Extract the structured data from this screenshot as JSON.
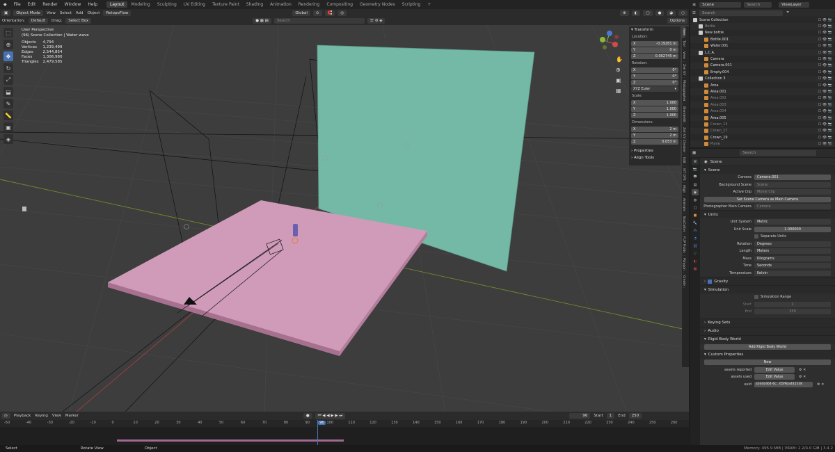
{
  "menu": [
    "File",
    "Edit",
    "Render",
    "Window",
    "Help"
  ],
  "workspaces": [
    "Layout",
    "Modeling",
    "Sculpting",
    "UV Editing",
    "Texture Paint",
    "Shading",
    "Animation",
    "Rendering",
    "Compositing",
    "Geometry Nodes",
    "Scripting"
  ],
  "active_workspace": "Layout",
  "scene_name": "Scene",
  "view_layer": "ViewLayer",
  "header": {
    "mode": "Object Mode",
    "menus": [
      "View",
      "Select",
      "Add",
      "Object"
    ],
    "addon_btn": "RetopoFlow",
    "transform": "Global",
    "orientation_label": "Orientation:",
    "orientation": "Default",
    "drag_label": "Drag:",
    "drag": "Select Box",
    "search_placeholder": "Search",
    "options": "Options"
  },
  "overlay": {
    "view": "User Perspective",
    "collection": "(96) Scene Collection | Water wave",
    "stats": [
      [
        "Objects",
        "4,794"
      ],
      [
        "Vertices",
        "1,239,499"
      ],
      [
        "Edges",
        "2,544,854"
      ],
      [
        "Faces",
        "1,306,980"
      ],
      [
        "Triangles",
        "2,479,585"
      ]
    ]
  },
  "npanel": {
    "transform": "Transform",
    "location": "Location:",
    "loc": [
      [
        "X",
        "-0.19281 m"
      ],
      [
        "Y",
        "0 m"
      ],
      [
        "Z",
        "0.002745 m"
      ]
    ],
    "rotation": "Rotation:",
    "rot": [
      [
        "X",
        "0°"
      ],
      [
        "Y",
        "0°"
      ],
      [
        "Z",
        "0°"
      ]
    ],
    "rot_mode": "XYZ Euler",
    "scale": "Scale:",
    "scl": [
      [
        "X",
        "1.000"
      ],
      [
        "Y",
        "1.000"
      ],
      [
        "Z",
        "1.000"
      ]
    ],
    "dimensions": "Dimensions:",
    "dim": [
      [
        "X",
        "2 m"
      ],
      [
        "Y",
        "2 m"
      ],
      [
        "Z",
        "0.053 m"
      ]
    ],
    "properties": "Properties",
    "align_tools": "Align Tools"
  },
  "vtabs": [
    "Item",
    "Tool",
    "View",
    "Zen UV",
    "Photographer",
    "Blenderkit",
    "Zen UV Checker",
    "Edit",
    "KIT OPS",
    "Align",
    "Animate",
    "BoxCutter",
    "FLIP Fluids",
    "Polygon",
    "Create"
  ],
  "outliner": {
    "search": "Search",
    "rows": [
      {
        "name": "Scene Collection",
        "indent": 0,
        "color": "#ddd"
      },
      {
        "name": "Bottle",
        "indent": 1,
        "color": "#888"
      },
      {
        "name": "New bottle",
        "indent": 1,
        "color": "#ddd"
      },
      {
        "name": "Bottle.001",
        "indent": 2,
        "color": "#ddd"
      },
      {
        "name": "Water.001",
        "indent": 2,
        "color": "#ddd"
      },
      {
        "name": "L.C.A.",
        "indent": 1,
        "color": "#ddd"
      },
      {
        "name": "Camera",
        "indent": 2,
        "color": "#ddd"
      },
      {
        "name": "Camera.001",
        "indent": 2,
        "color": "#ddd"
      },
      {
        "name": "Empty.004",
        "indent": 2,
        "color": "#ddd"
      },
      {
        "name": "Collection 3",
        "indent": 1,
        "color": "#ddd"
      },
      {
        "name": "Area",
        "indent": 2,
        "color": "#ddd"
      },
      {
        "name": "Area.001",
        "indent": 2,
        "color": "#ddd"
      },
      {
        "name": "Area.002",
        "indent": 2,
        "color": "#888"
      },
      {
        "name": "Area.003",
        "indent": 2,
        "color": "#888"
      },
      {
        "name": "Area.004",
        "indent": 2,
        "color": "#888"
      },
      {
        "name": "Area.005",
        "indent": 2,
        "color": "#ddd"
      },
      {
        "name": "Crown_13",
        "indent": 2,
        "color": "#888"
      },
      {
        "name": "Crown_17",
        "indent": 2,
        "color": "#888"
      },
      {
        "name": "Crown_19",
        "indent": 2,
        "color": "#ddd"
      },
      {
        "name": "Plane",
        "indent": 2,
        "color": "#888"
      }
    ]
  },
  "props": {
    "search": "Search",
    "title": "Scene",
    "scene_sect": "Scene",
    "camera_k": "Camera",
    "camera_v": "Camera.001",
    "bgscene_k": "Background Scene",
    "bgscene_v": "Scene",
    "clip_k": "Active Clip",
    "clip_v": "Movie Clip",
    "set_cam": "Set Scene Camera as Main Camera",
    "photo_k": "Photographer Main Camera",
    "photo_v": "Camera",
    "units_sect": "Units",
    "usys_k": "Unit System",
    "usys_v": "Metric",
    "uscale_k": "Unit Scale",
    "uscale_v": "1.000000",
    "sep_units": "Separate Units",
    "rot_k": "Rotation",
    "rot_v": "Degrees",
    "len_k": "Length",
    "len_v": "Meters",
    "mass_k": "Mass",
    "mass_v": "Kilograms",
    "time_k": "Time",
    "time_v": "Seconds",
    "temp_k": "Temperature",
    "temp_v": "Kelvin",
    "gravity": "Gravity",
    "sim_sect": "Simulation",
    "sim_range": "Simulation Range",
    "start_k": "Start",
    "start_v": "1",
    "end_k": "End",
    "end_v": "250",
    "keying": "Keying Sets",
    "audio": "Audio",
    "rbw": "Rigid Body World",
    "add_rbw": "Add Rigid Body World",
    "custom": "Custom Properties",
    "new": "New",
    "cp1_k": "assets reported",
    "cp1_v": "Edit Value",
    "cp2_k": "assets used",
    "cp2_v": "Edit Value",
    "cp3_k": "uuid",
    "cp3_v": "a5ddb464-6c...65f9ba442338"
  },
  "timeline": {
    "menus": [
      "Playback",
      "Keying",
      "View",
      "Marker"
    ],
    "frame": "96",
    "start_k": "Start",
    "start_v": "1",
    "end_k": "End",
    "end_v": "250",
    "ticks": [
      "-50",
      "-40",
      "-30",
      "-20",
      "-10",
      "0",
      "10",
      "20",
      "30",
      "40",
      "50",
      "60",
      "70",
      "80",
      "90",
      "96",
      "100",
      "110",
      "120",
      "130",
      "140",
      "150",
      "160",
      "170",
      "180",
      "190",
      "200",
      "210",
      "220",
      "230",
      "240",
      "250",
      "260"
    ]
  },
  "status": {
    "select": "Select",
    "rotate": "Rotate View",
    "object": "Object",
    "memory": "Memory: 495.9 MiB | VRAM: 2.2/4.0 GiB | 3.4.2"
  }
}
